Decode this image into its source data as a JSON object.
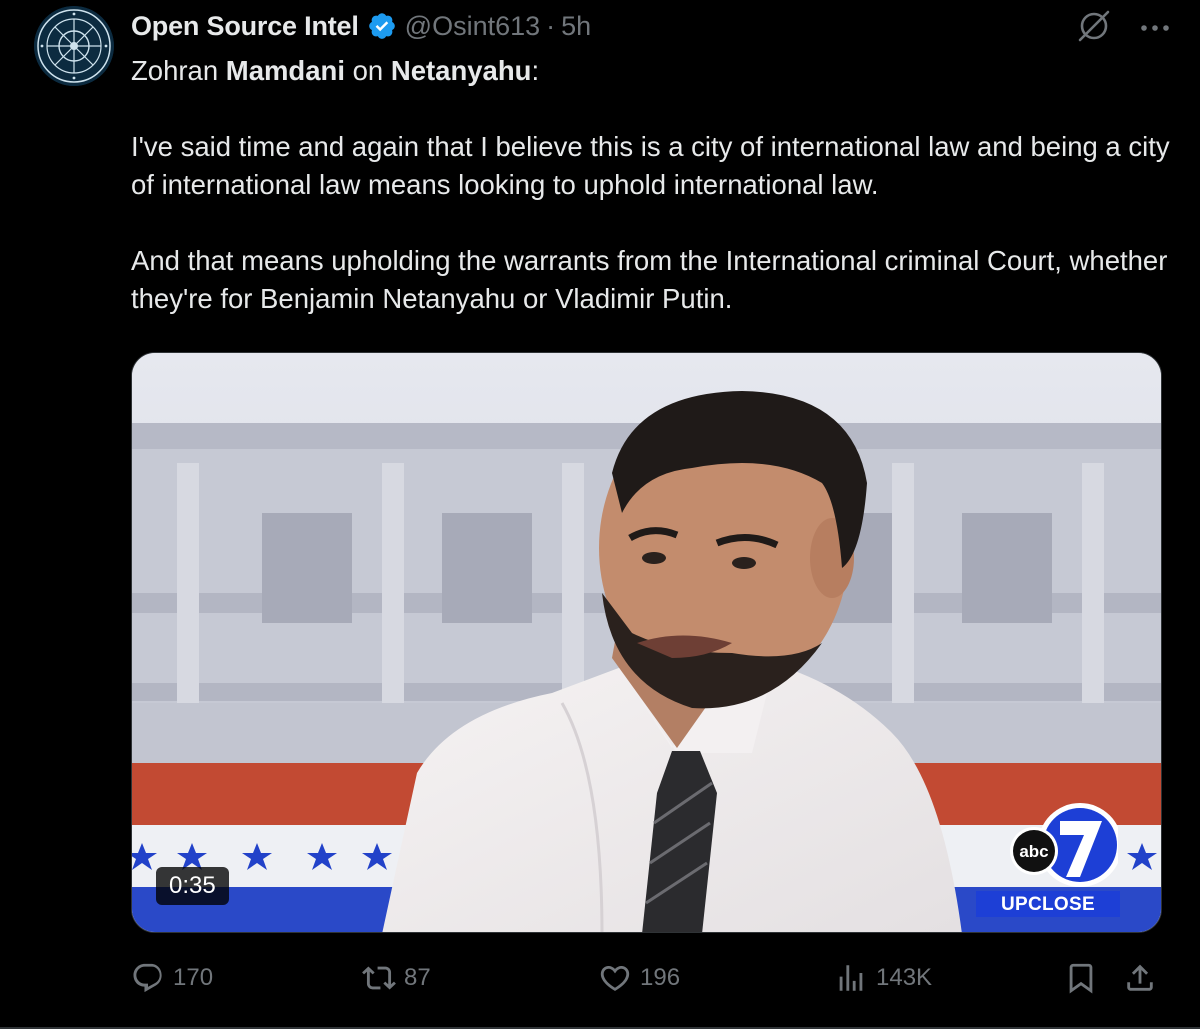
{
  "author": {
    "display_name": "Open Source Intel",
    "handle": "@Osint613",
    "separator": "·",
    "time": "5h",
    "verified": true,
    "avatar_icon": "osint-seal-avatar"
  },
  "top_actions": {
    "grok_icon": "grok-icon",
    "more_icon": "more-options-icon",
    "more_label": "···"
  },
  "text": {
    "line1_a": "Zohran ",
    "line1_b": "Mamdani",
    "line1_c": " on ",
    "line1_d": "Netanyahu",
    "line1_e": ":",
    "para2": "I've said time and again that I believe this is a city of international law and being a city of international law means looking to uphold international law.",
    "para3": "And that means upholding the warrants from the International criminal Court, whether they're for Benjamin Netanyahu or Vladimir Putin."
  },
  "media": {
    "type": "video",
    "duration": "0:35",
    "station_logo_text": "abc",
    "station_number": "7",
    "show_name": "UPCLOSE"
  },
  "actions": {
    "replies": "170",
    "retweets": "87",
    "likes": "196",
    "views": "143K"
  },
  "colors": {
    "background": "#000000",
    "text_primary": "#e7e9ea",
    "text_secondary": "#71767b",
    "verified_blue": "#1d9bf0",
    "abc_blue": "#1d3fd6"
  }
}
